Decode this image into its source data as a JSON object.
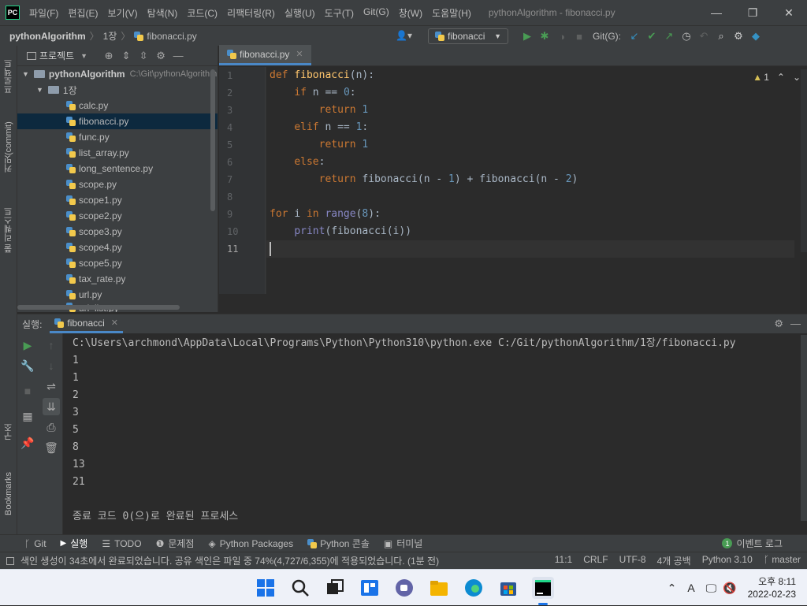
{
  "app": {
    "logo": "PC",
    "window_title": "pythonAlgorithm - fibonacci.py"
  },
  "menu": [
    "파일(F)",
    "편집(E)",
    "보기(V)",
    "탐색(N)",
    "코드(C)",
    "리팩터링(R)",
    "실행(U)",
    "도구(T)",
    "Git(G)",
    "창(W)",
    "도움말(H)"
  ],
  "window_controls": {
    "minimize": "—",
    "restore": "❐",
    "close": "✕"
  },
  "navbar": {
    "project": "pythonAlgorithm",
    "folder": "1장",
    "file": "fibonacci.py",
    "run_config": "fibonacci",
    "git_label": "Git(G):"
  },
  "left_strip": {
    "project": "프로젝트",
    "commit": "커밋(commit)",
    "pull_requests": "풀 리퀘스트",
    "structure": "구조",
    "bookmarks": "Bookmarks"
  },
  "project_panel": {
    "title": "프로젝트",
    "root": "pythonAlgorithm",
    "root_path": "C:\\Git\\pythonAlgorithm",
    "folder": "1장",
    "files": [
      "calc.py",
      "fibonacci.py",
      "func.py",
      "list_array.py",
      "long_sentence.py",
      "scope.py",
      "scope1.py",
      "scope2.py",
      "scope3.py",
      "scope4.py",
      "scope5.py",
      "tax_rate.py",
      "url.py",
      "url_list.py"
    ],
    "selected": "fibonacci.py"
  },
  "editor": {
    "tab": "fibonacci.py",
    "inspection": "1",
    "line_numbers": [
      "1",
      "2",
      "3",
      "4",
      "5",
      "6",
      "7",
      "8",
      "9",
      "10",
      "11"
    ],
    "lines": [
      [
        {
          "t": "def ",
          "c": "kw"
        },
        {
          "t": "fibonacci",
          "c": "fn"
        },
        {
          "t": "(n):",
          "c": ""
        }
      ],
      [
        {
          "t": "    ",
          "c": ""
        },
        {
          "t": "if ",
          "c": "kw"
        },
        {
          "t": "n == ",
          "c": ""
        },
        {
          "t": "0",
          "c": "num"
        },
        {
          "t": ":",
          "c": ""
        }
      ],
      [
        {
          "t": "        ",
          "c": ""
        },
        {
          "t": "return ",
          "c": "kw"
        },
        {
          "t": "1",
          "c": "num"
        }
      ],
      [
        {
          "t": "    ",
          "c": ""
        },
        {
          "t": "elif ",
          "c": "kw"
        },
        {
          "t": "n == ",
          "c": ""
        },
        {
          "t": "1",
          "c": "num"
        },
        {
          "t": ":",
          "c": ""
        }
      ],
      [
        {
          "t": "        ",
          "c": ""
        },
        {
          "t": "return ",
          "c": "kw"
        },
        {
          "t": "1",
          "c": "num"
        }
      ],
      [
        {
          "t": "    ",
          "c": ""
        },
        {
          "t": "else",
          "c": "kw"
        },
        {
          "t": ":",
          "c": ""
        }
      ],
      [
        {
          "t": "        ",
          "c": ""
        },
        {
          "t": "return ",
          "c": "kw"
        },
        {
          "t": "fibonacci(n - ",
          "c": ""
        },
        {
          "t": "1",
          "c": "num"
        },
        {
          "t": ") + fibonacci(n - ",
          "c": ""
        },
        {
          "t": "2",
          "c": "num"
        },
        {
          "t": ")",
          "c": ""
        }
      ],
      [],
      [
        {
          "t": "for ",
          "c": "kw"
        },
        {
          "t": "i ",
          "c": ""
        },
        {
          "t": "in ",
          "c": "kw"
        },
        {
          "t": "range",
          "c": "bi"
        },
        {
          "t": "(",
          "c": ""
        },
        {
          "t": "8",
          "c": "num"
        },
        {
          "t": "):",
          "c": ""
        }
      ],
      [
        {
          "t": "    ",
          "c": ""
        },
        {
          "t": "print",
          "c": "bi"
        },
        {
          "t": "(fibonacci(i))",
          "c": ""
        }
      ],
      []
    ]
  },
  "run_panel": {
    "label": "실행:",
    "tab": "fibonacci",
    "output": [
      "C:\\Users\\archmond\\AppData\\Local\\Programs\\Python\\Python310\\python.exe C:/Git/pythonAlgorithm/1장/fibonacci.py",
      "1",
      "1",
      "2",
      "3",
      "5",
      "8",
      "13",
      "21",
      "",
      "종료 코드 0(으)로 완료된 프로세스"
    ]
  },
  "bottom_tabs": [
    "Git",
    "실행",
    "TODO",
    "문제점",
    "Python Packages",
    "Python 콘솔",
    "터미널"
  ],
  "event_log": {
    "count": "1",
    "label": "이벤트 로그"
  },
  "status": {
    "message": "색인 생성이 34초에서 완료되었습니다. 공유 색인은 파일 중 74%(4,727/6,355)에 적용되었습니다. (1분 전)",
    "position": "11:1",
    "line_sep": "CRLF",
    "encoding": "UTF-8",
    "indent": "4개 공백",
    "interpreter": "Python 3.10",
    "branch": "master"
  },
  "taskbar": {
    "ime": "A",
    "time": "오후 8:11",
    "date": "2022-02-23"
  }
}
